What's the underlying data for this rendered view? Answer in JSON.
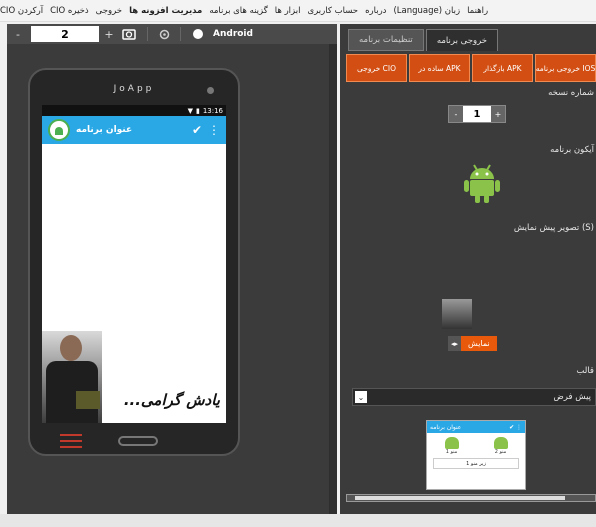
{
  "menu": {
    "items": [
      "آرکردن CIO",
      "ذخیره CIO",
      "خروجی",
      "مدیریت افزونه ها",
      "گزینه های برنامه",
      "ابزار ها",
      "حساب کاربری",
      "درباره",
      "زبان (Language)",
      "راهنما"
    ]
  },
  "toolbar": {
    "zoom_value": "2",
    "minus": "-",
    "plus": "+",
    "platform": "Android"
  },
  "phone": {
    "brand": "JoApp",
    "time": "13:16",
    "app_title": "عنوان برنامه",
    "caption": "یادش گرامی...",
    "accent": "#2aa8e6"
  },
  "right_panel": {
    "tabs": [
      "تنظیمات برنامه",
      "خروجی برنامه"
    ],
    "active_tab": "خروجی برنامه",
    "subtabs": [
      "خروجی برنامه IOS",
      "بازگذار APK",
      "ساده در APK",
      "خروجی CIO"
    ],
    "version_label": "شماره نسخه",
    "version_value": "1",
    "icon_label": "آیکون برنامه",
    "preview_label": "(S) تصویر پیش نمایش",
    "show_button": "نمایش",
    "template_label": "قالب",
    "template_value": "پیش فرض",
    "mini_title": "عنوان برنامه",
    "mini_cell_1": "منو 1",
    "mini_cell_2": "منو 2",
    "mini_list": "زیر منو 1"
  }
}
